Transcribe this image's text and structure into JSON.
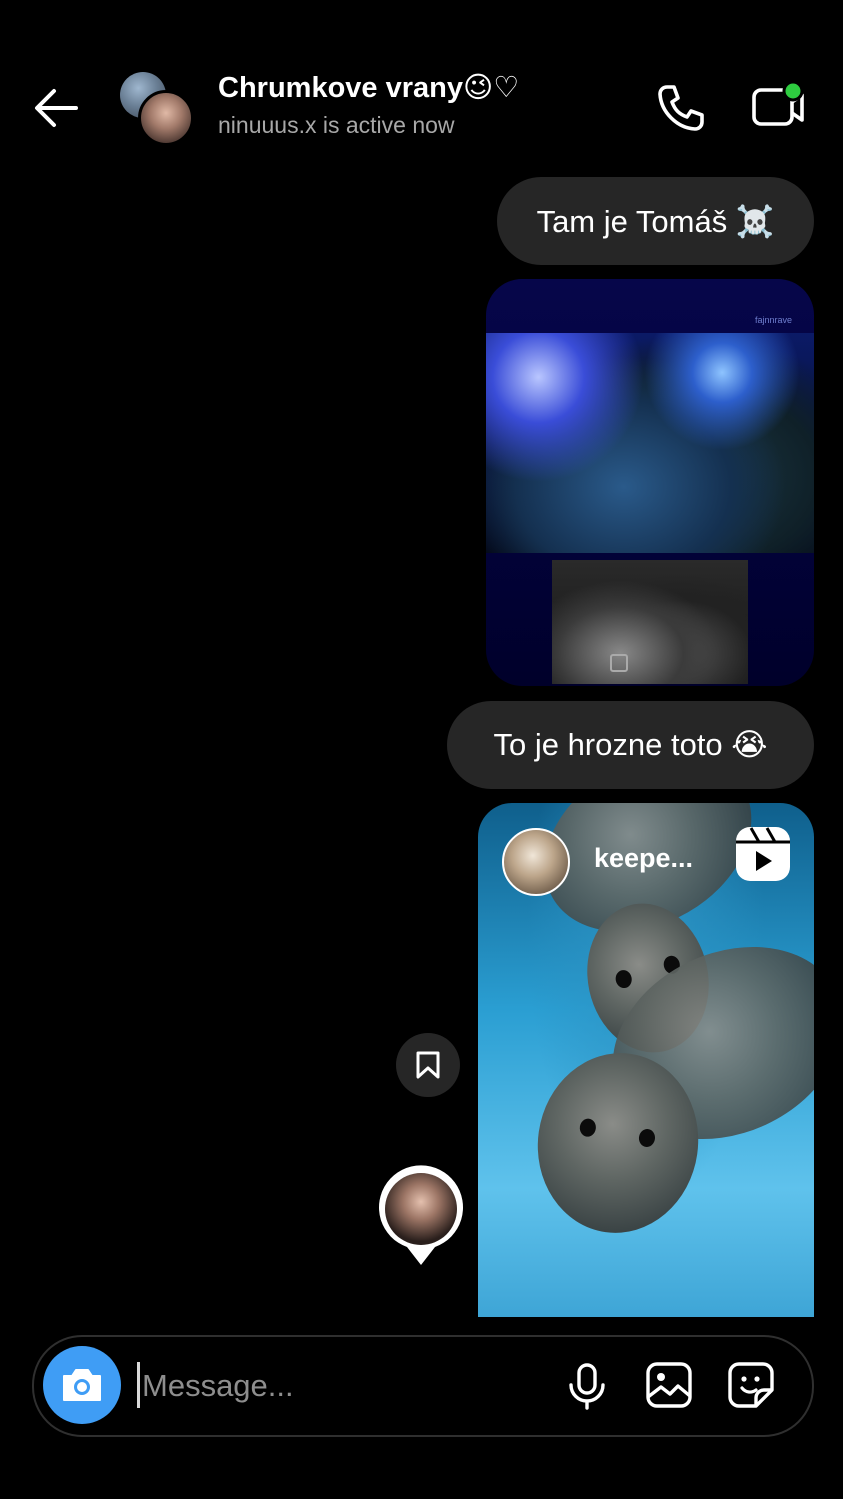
{
  "header": {
    "title": "Chrumkove vrany😉♡",
    "subtitle": "ninuuus.x is active now",
    "icons": [
      "back-arrow-icon",
      "phone-icon",
      "video-camera-icon"
    ],
    "online_dot_color": "#2ecc40"
  },
  "messages": [
    {
      "type": "text",
      "text": "Tam je Tomáš ☠️"
    },
    {
      "type": "image",
      "watermark": "fajnnrave"
    },
    {
      "type": "text",
      "text": "To je hrozne toto 😭"
    },
    {
      "type": "reel",
      "username": "keepe..."
    }
  ],
  "composer": {
    "placeholder": "Message...",
    "value": "",
    "camera_color": "#3f9df5",
    "icons": [
      "microphone-icon",
      "gallery-icon",
      "sticker-icon"
    ]
  }
}
